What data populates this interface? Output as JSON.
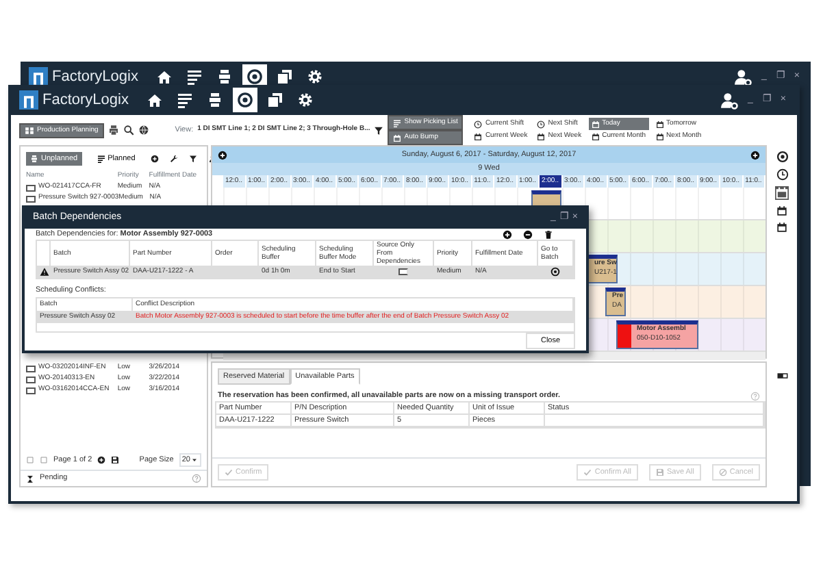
{
  "back_window": {
    "title": "FactoryLogix",
    "nav_icons": [
      {
        "kind": "home",
        "selected": false
      },
      {
        "kind": "list",
        "selected": false
      },
      {
        "kind": "stack",
        "selected": false
      },
      {
        "kind": "target",
        "selected": true
      },
      {
        "kind": "windows",
        "selected": false
      },
      {
        "kind": "settings",
        "selected": false
      }
    ],
    "window_controls": [
      "_",
      "❐",
      "×"
    ]
  },
  "window": {
    "title": "FactoryLogix",
    "nav_icons": [
      {
        "kind": "home",
        "selected": false
      },
      {
        "kind": "list",
        "selected": false
      },
      {
        "kind": "stack",
        "selected": false
      },
      {
        "kind": "target",
        "selected": true
      },
      {
        "kind": "windows",
        "selected": false
      },
      {
        "kind": "settings",
        "selected": false
      }
    ],
    "window_controls": [
      "_",
      "❐",
      "×"
    ]
  },
  "toolbar": {
    "module_button": "Production Planning",
    "view_label": "View:",
    "view_value": "1 DI SMT Line 1; 2 DI SMT Line 2; 3 Through-Hole B...",
    "toggles": [
      {
        "label": "Show Picking List",
        "on": true
      },
      {
        "label": "Auto Bump",
        "on": true
      }
    ],
    "ranges": [
      {
        "label": "Current Shift",
        "kind": "clock",
        "selected": false
      },
      {
        "label": "Next Shift",
        "kind": "clock",
        "selected": false
      },
      {
        "label": "Today",
        "kind": "calendar",
        "selected": true
      },
      {
        "label": "Tomorrow",
        "kind": "calendar",
        "selected": false
      },
      {
        "label": "Current Week",
        "kind": "calendar",
        "selected": false
      },
      {
        "label": "Next Week",
        "kind": "calendar",
        "selected": false
      },
      {
        "label": "Current Month",
        "kind": "calendar",
        "selected": false
      },
      {
        "label": "Next Month",
        "kind": "calendar",
        "selected": false
      }
    ]
  },
  "left_panel": {
    "tabs": [
      {
        "label": "Unplanned",
        "selected": true
      },
      {
        "label": "Planned",
        "selected": false
      }
    ],
    "columns": [
      "Name",
      "Priority",
      "Fulfillment Date"
    ],
    "rows": [
      {
        "name": "WO-021417CCA-FR",
        "priority": "Medium",
        "date": "N/A",
        "checked": false
      },
      {
        "name": "Pressure Switch 927-0003",
        "priority": "Medium",
        "date": "N/A",
        "checked": false
      }
    ],
    "rows_below": [
      {
        "name": "WO-03202014INF-EN",
        "priority": "Low",
        "date": "3/26/2014",
        "checked": false
      },
      {
        "name": "WO-20140313-EN",
        "priority": "Low",
        "date": "3/22/2014",
        "checked": false
      },
      {
        "name": "WO-03162014CCA-EN",
        "priority": "Low",
        "date": "3/16/2014",
        "checked": false
      }
    ],
    "pager": {
      "page": "Page 1 of 2",
      "page_size_label": "Page Size",
      "page_size": "20"
    },
    "status": "Pending"
  },
  "gantt": {
    "week": "Sunday, August 6, 2017 - Saturday, August 12, 2017",
    "day": "9 Wed",
    "hours": [
      "12:0..",
      "1:00..",
      "2:00..",
      "3:00..",
      "4:00..",
      "5:00..",
      "6:00..",
      "7:00..",
      "8:00..",
      "9:00..",
      "10:0..",
      "11:0..",
      "12:0..",
      "1:00..",
      "2:00..",
      "3:00..",
      "4:00..",
      "5:00..",
      "6:00..",
      "7:00..",
      "8:00..",
      "9:00..",
      "10:0..",
      "11:0.."
    ],
    "current_hour_index_selected": [
      false,
      false,
      false,
      false,
      false,
      false,
      false,
      false,
      false,
      false,
      false,
      false,
      false,
      false,
      true,
      false,
      false,
      false,
      false,
      false,
      false,
      false,
      false,
      false
    ],
    "lanes": [
      {
        "color": "#ffffff"
      },
      {
        "color": "#eef6e2"
      },
      {
        "color": "#e5f2f9"
      },
      {
        "color": "#fcefe2"
      },
      {
        "color": "#f1ecf8"
      }
    ],
    "bars": [
      {
        "color": "#d9bd8f"
      },
      {
        "title": "ure Sw",
        "code": "U217-1",
        "color": "#d9bd8f"
      },
      {
        "title": "Pre",
        "code": "DA",
        "color": "#d9bd8f"
      },
      {
        "title": "Motor Assembl",
        "code": "050-D10-1052",
        "color": "#f5a3a3",
        "alert": true
      }
    ]
  },
  "dialog": {
    "title": "Batch Dependencies",
    "window_controls": [
      "_",
      "❐",
      "×"
    ],
    "subtitle": "Batch Dependencies for: **Motor Assembly 927-0003**",
    "columns": [
      "Batch",
      "Part Number",
      "Order",
      "Scheduling Buffer",
      "Scheduling Buffer Mode",
      "Source Only From Dependencies",
      "Priority",
      "Fulfillment Date",
      "Go to Batch"
    ],
    "rows": [
      {
        "warning": true,
        "batch": "Pressure Switch Assy 02",
        "part": "DAA-U217-1222 - A",
        "buffer": "0d 1h 0m",
        "mode": "End to Start",
        "source_only": false,
        "priority": "Medium",
        "date": "N/A"
      }
    ],
    "conflicts_label": "Scheduling Conflicts:",
    "conflict_columns": [
      "Batch",
      "Conflict Description"
    ],
    "conflicts": [
      {
        "batch": "Pressure Switch Assy 02",
        "description": "Batch Motor Assembly 927-0003 is scheduled to start before the time buffer after the end of Batch Pressure Switch Assy 02"
      }
    ],
    "close_button": "Close"
  },
  "bottom_panel": {
    "tabs": [
      {
        "label": "Reserved Material",
        "selected": false
      },
      {
        "label": "Unavailable Parts",
        "selected": true
      }
    ],
    "message": "The reservation has been confirmed, all unavailable parts are now on a missing transport order.",
    "columns": [
      "Part Number",
      "P/N Description",
      "Needed Quantity",
      "Unit of Issue",
      "Status"
    ],
    "rows": [
      [
        "DAA-U217-1222",
        "Pressure Switch",
        "5",
        "Pieces"
      ]
    ],
    "buttons": [
      {
        "label": "Confirm",
        "kind": "check",
        "disabled": true
      },
      {
        "label": "Confirm All",
        "kind": "check",
        "disabled": true
      },
      {
        "label": "Save All",
        "kind": "save",
        "disabled": true
      },
      {
        "label": "Cancel",
        "kind": "cancel",
        "disabled": true
      }
    ]
  }
}
